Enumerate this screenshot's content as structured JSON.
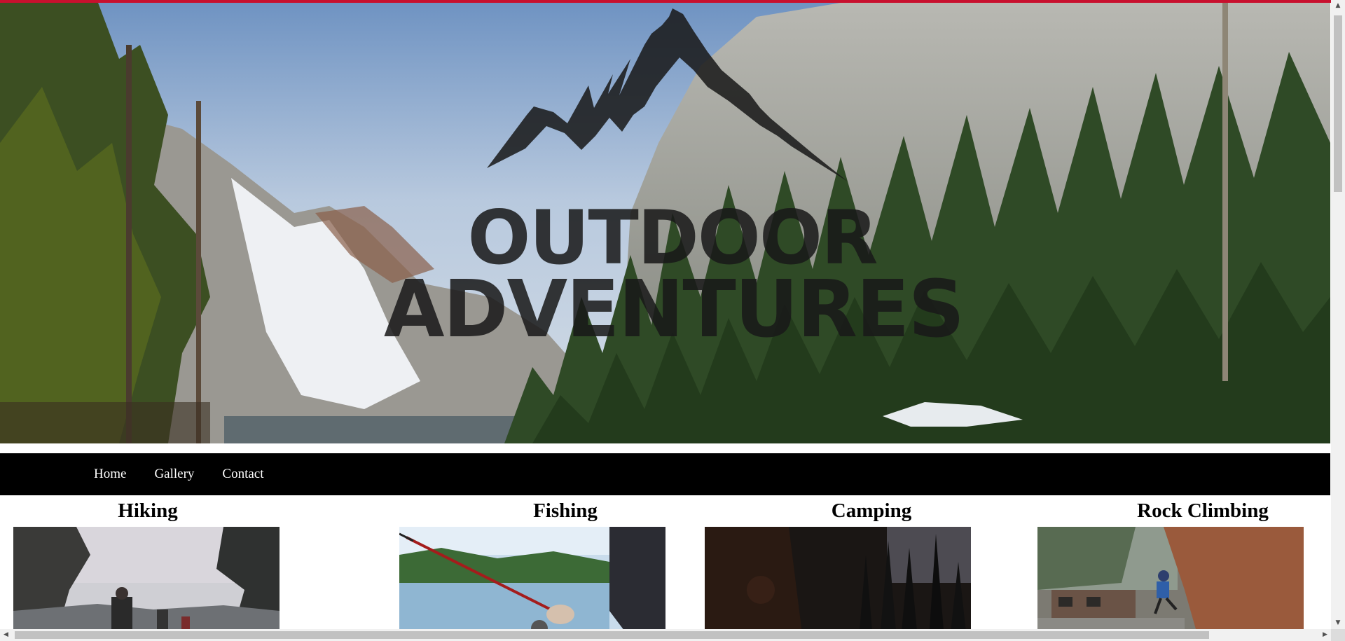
{
  "brand": {
    "line1": "OUTDOOR",
    "line2": "ADVENTURES"
  },
  "nav": {
    "items": [
      {
        "label": "Home"
      },
      {
        "label": "Gallery"
      },
      {
        "label": "Contact"
      }
    ]
  },
  "activities": [
    {
      "title": "Hiking"
    },
    {
      "title": "Fishing"
    },
    {
      "title": "Camping"
    },
    {
      "title": "Rock Climbing"
    }
  ],
  "colors": {
    "accent_strip": "#c8102e",
    "nav_background": "#000000",
    "nav_text": "#ffffff"
  },
  "icons": {
    "scroll_up": "triangle-up",
    "scroll_down": "triangle-down",
    "scroll_left": "triangle-left",
    "scroll_right": "triangle-right"
  }
}
